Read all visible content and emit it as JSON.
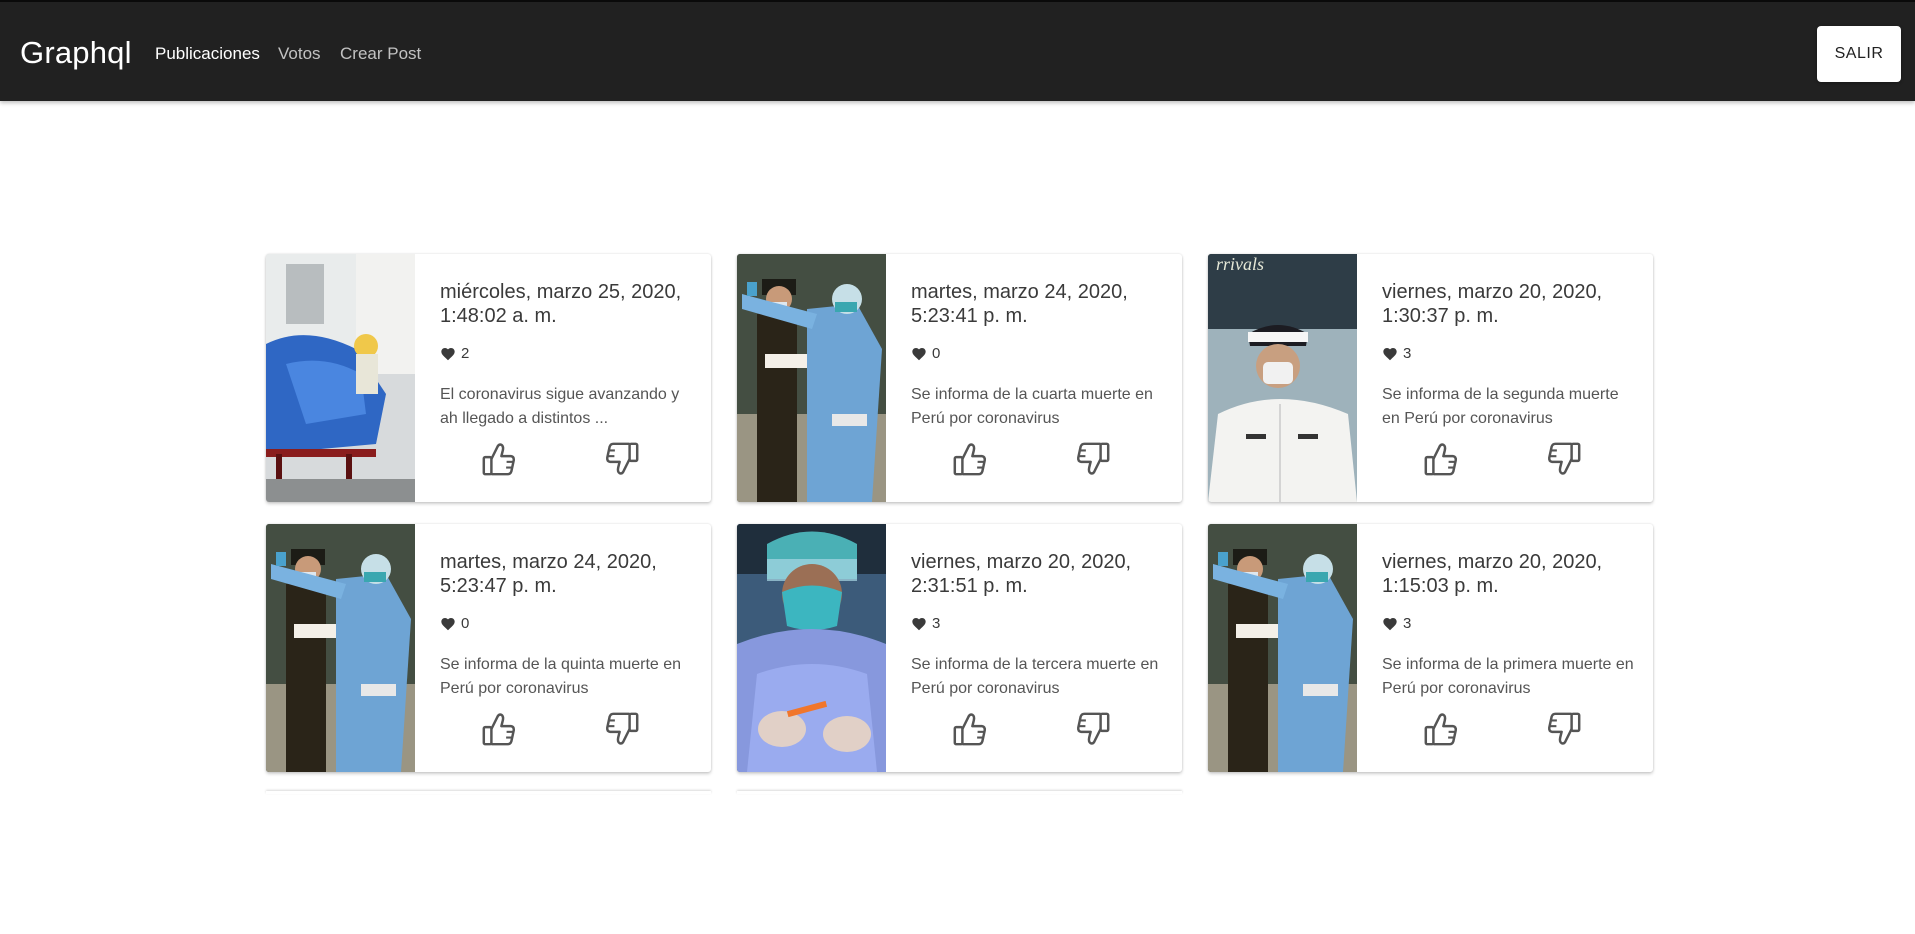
{
  "navbar": {
    "brand": "Graphql",
    "links": [
      {
        "label": "Publicaciones",
        "active": true
      },
      {
        "label": "Votos",
        "active": false
      },
      {
        "label": "Crear Post",
        "active": false
      }
    ],
    "logout_label": "SALIR"
  },
  "posts": [
    {
      "date": "miércoles, marzo 25, 2020, 1:48:02 a. m.",
      "likes": "2",
      "description": "El coronavirus sigue avanzando y ah llegado a distintos ...",
      "image": "stretcher-photo"
    },
    {
      "date": "martes, marzo 24, 2020, 5:23:41 p. m.",
      "likes": "0",
      "description": "Se informa de la cuarta muerte en Perú por coronavirus",
      "image": "health-worker-thermometer-photo"
    },
    {
      "date": "viernes, marzo 20, 2020, 1:30:37 p. m.",
      "likes": "3",
      "description": "Se informa de la segunda muerte en Perú por coronavirus",
      "image": "officer-mask-photo"
    },
    {
      "date": "martes, marzo 24, 2020, 5:23:47 p. m.",
      "likes": "0",
      "description": "Se informa de la quinta muerte en Perú por coronavirus",
      "image": "health-worker-thermometer-photo"
    },
    {
      "date": "viernes, marzo 20, 2020, 2:31:51 p. m.",
      "likes": "3",
      "description": "Se informa de la tercera muerte en Perú por coronavirus",
      "image": "lab-technician-photo"
    },
    {
      "date": "viernes, marzo 20, 2020, 1:15:03 p. m.",
      "likes": "3",
      "description": "Se informa de la primera muerte en Perú por coronavirus",
      "image": "health-worker-thermometer-photo"
    }
  ],
  "icons": {
    "likes": "heart-icon",
    "upvote": "thumbs-up-icon",
    "downvote": "thumbs-down-icon"
  },
  "colors": {
    "navbar": "#212121",
    "icon": "#555555"
  }
}
